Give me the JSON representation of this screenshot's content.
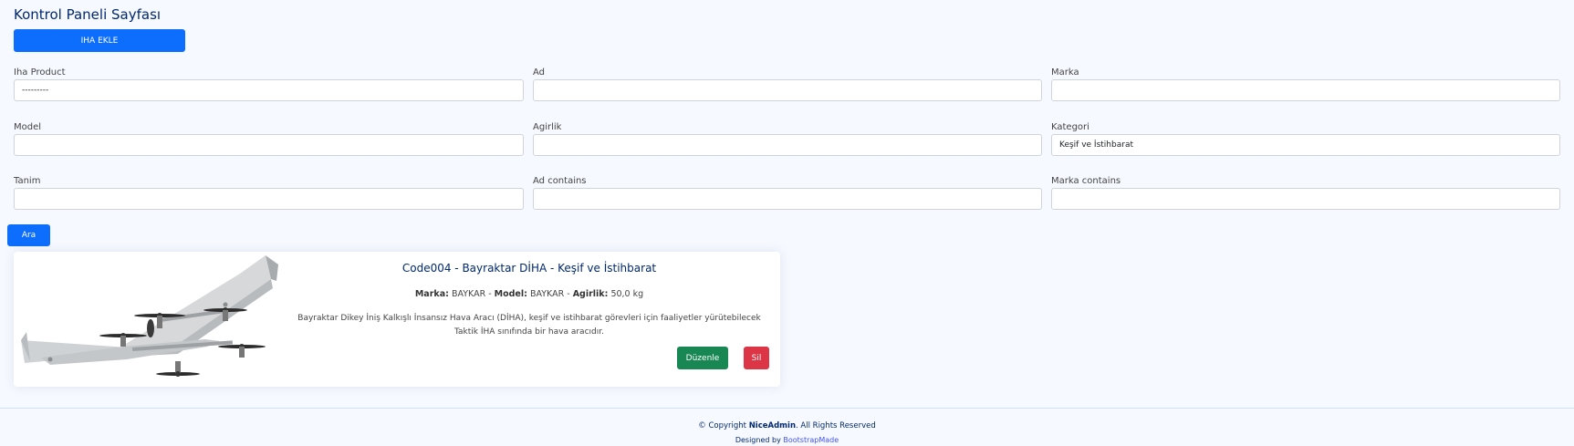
{
  "page": {
    "title": "Kontrol Paneli Sayfası"
  },
  "toolbar": {
    "add_label": "IHA EKLE",
    "search_label": "Ara"
  },
  "filters": [
    {
      "label": "Iha Product",
      "value": "---------"
    },
    {
      "label": "Ad",
      "value": ""
    },
    {
      "label": "Marka",
      "value": ""
    },
    {
      "label": "Model",
      "value": ""
    },
    {
      "label": "Agirlik",
      "value": ""
    },
    {
      "label": "Kategori",
      "value": "Keşif ve İstihbarat"
    },
    {
      "label": "Tanim",
      "value": ""
    },
    {
      "label": "Ad contains",
      "value": ""
    },
    {
      "label": "Marka contains",
      "value": ""
    }
  ],
  "card": {
    "title": "Code004 - Bayraktar DİHA - Keşif ve İstihbarat",
    "brand_label": "Marka:",
    "brand": "BAYKAR",
    "model_label": "Model:",
    "model": "BAYKAR",
    "weight_label": "Agirlik:",
    "weight": "50,0 kg",
    "separator": " - ",
    "desc_line1": "Bayraktar Dikey İniş Kalkışlı İnsansız Hava Aracı (DİHA), keşif ve istihbarat görevleri için faaliyetler yürütebilecek",
    "desc_line2": "Taktik İHA sınıfında bir hava aracıdır.",
    "edit_label": "Düzenle",
    "delete_label": "Sil"
  },
  "footer": {
    "copyright_prefix": "© Copyright ",
    "brand": "NiceAdmin",
    "copyright_suffix": ". All Rights Reserved",
    "designed_by": "Designed by ",
    "designer": "BootstrapMade"
  },
  "colors": {
    "primary": "#0d6efd",
    "success": "#198754",
    "danger": "#dc3545",
    "title": "#012970",
    "background": "#f6f9ff"
  }
}
